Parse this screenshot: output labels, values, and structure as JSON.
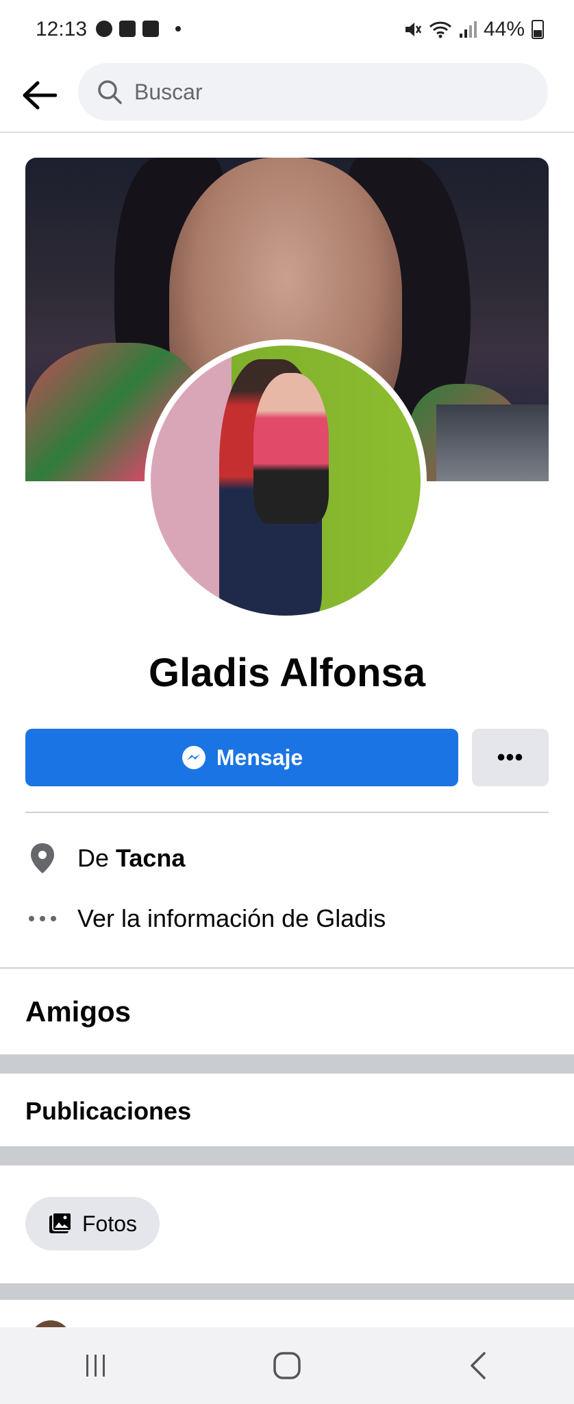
{
  "status_bar": {
    "time": "12:13",
    "battery": "44%"
  },
  "search": {
    "placeholder": "Buscar"
  },
  "profile": {
    "name": "Gladis Alfonsa",
    "message_button": "Mensaje",
    "more_button": "•••",
    "location_prefix": "De",
    "location_city": "Tacna",
    "info_link": "Ver la información de Gladis"
  },
  "sections": {
    "friends": "Amigos",
    "posts": "Publicaciones",
    "photos_chip": "Fotos"
  },
  "colors": {
    "accent": "#1b74e4",
    "secondary_button": "#e4e6eb",
    "search_bg": "#f0f2f5"
  },
  "icons": [
    "back-arrow-icon",
    "search-icon",
    "messenger-icon",
    "more-icon",
    "location-pin-icon",
    "ellipsis-icon",
    "photos-icon",
    "recents-icon",
    "home-icon",
    "nav-back-icon"
  ]
}
